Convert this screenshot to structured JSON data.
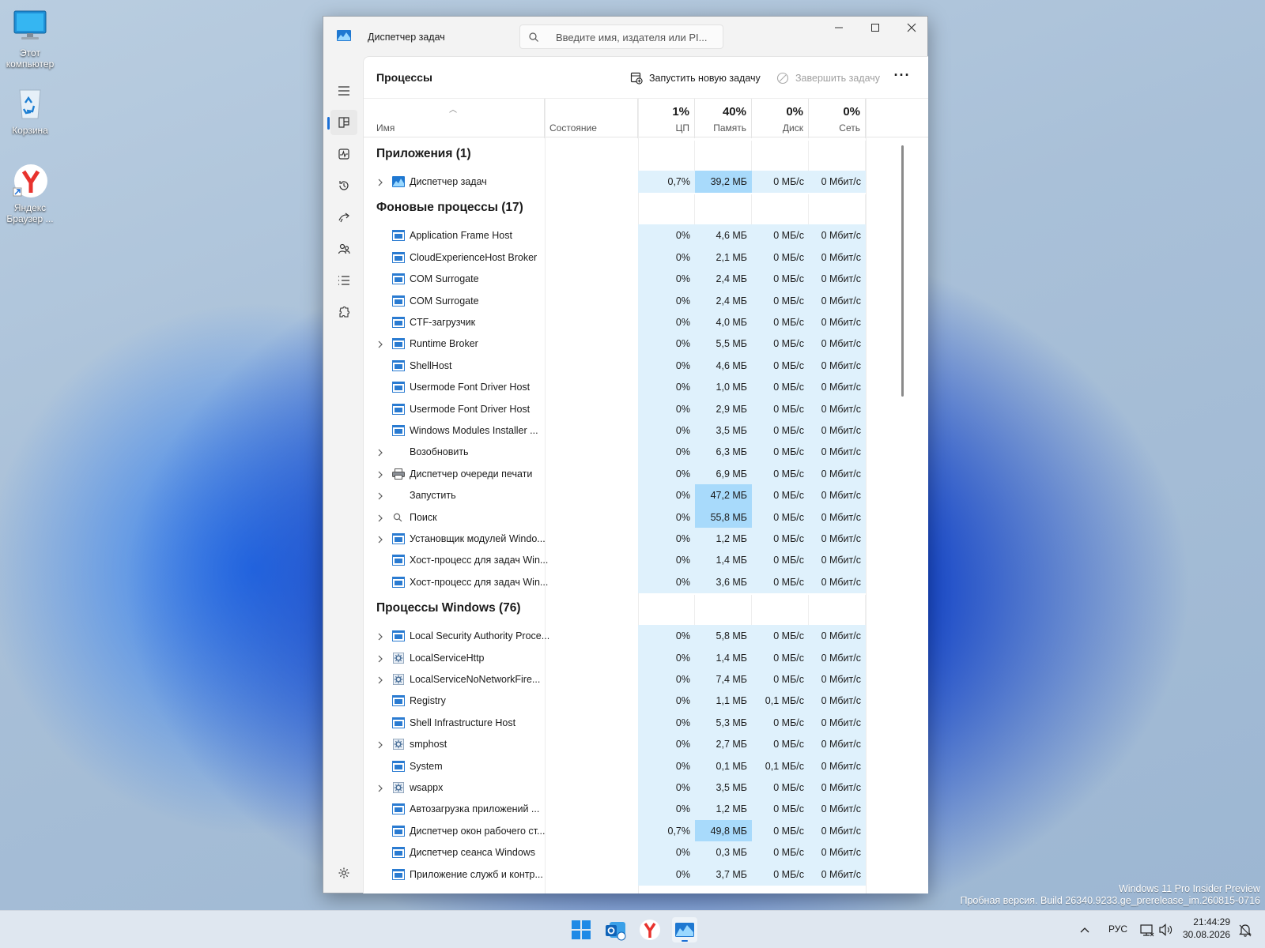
{
  "desktop": {
    "icons": [
      {
        "label": "Этот компьютер",
        "icon": "monitor-icon"
      },
      {
        "label": "Корзина",
        "icon": "recycle-bin-icon"
      },
      {
        "label": "Яндекс Браузер ...",
        "icon": "yandex-browser-icon"
      }
    ],
    "watermark_line1": "Windows 11 Pro Insider Preview",
    "watermark_line2": "Пробная версия. Build 26340.9233.ge_prerelease_im.260815-0716"
  },
  "window": {
    "title": "Диспетчер задач",
    "search_placeholder": "Введите имя, издателя или PI...",
    "page_title": "Процессы",
    "run_task": "Запустить новую задачу",
    "end_task": "Завершить задачу",
    "more": "···"
  },
  "columns": {
    "name": "Имя",
    "status": "Состояние",
    "cpu_pct": "1%",
    "cpu": "ЦП",
    "mem_pct": "40%",
    "mem": "Память",
    "disk_pct": "0%",
    "disk": "Диск",
    "net_pct": "0%",
    "net": "Сеть"
  },
  "groups": [
    {
      "title": "Приложения (1)",
      "rows": [
        {
          "name": "Диспетчер задач",
          "expand": true,
          "icon": "taskmgr",
          "cpu": "0,7%",
          "mem": "39,2 МБ",
          "disk": "0 МБ/с",
          "net": "0 Мбит/с",
          "mem_hi": true
        }
      ]
    },
    {
      "title": "Фоновые процессы (17)",
      "rows": [
        {
          "name": "Application Frame Host",
          "expand": false,
          "icon": "app",
          "cpu": "0%",
          "mem": "4,6 МБ",
          "disk": "0 МБ/с",
          "net": "0 Мбит/с"
        },
        {
          "name": "CloudExperienceHost Broker",
          "expand": false,
          "icon": "app",
          "cpu": "0%",
          "mem": "2,1 МБ",
          "disk": "0 МБ/с",
          "net": "0 Мбит/с"
        },
        {
          "name": "COM Surrogate",
          "expand": false,
          "icon": "app",
          "cpu": "0%",
          "mem": "2,4 МБ",
          "disk": "0 МБ/с",
          "net": "0 Мбит/с"
        },
        {
          "name": "COM Surrogate",
          "expand": false,
          "icon": "app",
          "cpu": "0%",
          "mem": "2,4 МБ",
          "disk": "0 МБ/с",
          "net": "0 Мбит/с"
        },
        {
          "name": "CTF-загрузчик",
          "expand": false,
          "icon": "app",
          "cpu": "0%",
          "mem": "4,0 МБ",
          "disk": "0 МБ/с",
          "net": "0 Мбит/с"
        },
        {
          "name": "Runtime Broker",
          "expand": true,
          "icon": "app",
          "cpu": "0%",
          "mem": "5,5 МБ",
          "disk": "0 МБ/с",
          "net": "0 Мбит/с"
        },
        {
          "name": "ShellHost",
          "expand": false,
          "icon": "app",
          "cpu": "0%",
          "mem": "4,6 МБ",
          "disk": "0 МБ/с",
          "net": "0 Мбит/с"
        },
        {
          "name": "Usermode Font Driver Host",
          "expand": false,
          "icon": "app",
          "cpu": "0%",
          "mem": "1,0 МБ",
          "disk": "0 МБ/с",
          "net": "0 Мбит/с"
        },
        {
          "name": "Usermode Font Driver Host",
          "expand": false,
          "icon": "app",
          "cpu": "0%",
          "mem": "2,9 МБ",
          "disk": "0 МБ/с",
          "net": "0 Мбит/с"
        },
        {
          "name": "Windows Modules Installer ...",
          "expand": false,
          "icon": "app",
          "cpu": "0%",
          "mem": "3,5 МБ",
          "disk": "0 МБ/с",
          "net": "0 Мбит/с"
        },
        {
          "name": "Возобновить",
          "expand": true,
          "icon": "none",
          "cpu": "0%",
          "mem": "6,3 МБ",
          "disk": "0 МБ/с",
          "net": "0 Мбит/с"
        },
        {
          "name": "Диспетчер очереди печати",
          "expand": true,
          "icon": "printer",
          "cpu": "0%",
          "mem": "6,9 МБ",
          "disk": "0 МБ/с",
          "net": "0 Мбит/с"
        },
        {
          "name": "Запустить",
          "expand": true,
          "icon": "none",
          "cpu": "0%",
          "mem": "47,2 МБ",
          "disk": "0 МБ/с",
          "net": "0 Мбит/с",
          "mem_hi": true
        },
        {
          "name": "Поиск",
          "expand": true,
          "icon": "search",
          "cpu": "0%",
          "mem": "55,8 МБ",
          "disk": "0 МБ/с",
          "net": "0 Мбит/с",
          "mem_hi": true
        },
        {
          "name": "Установщик модулей Windo...",
          "expand": true,
          "icon": "app",
          "cpu": "0%",
          "mem": "1,2 МБ",
          "disk": "0 МБ/с",
          "net": "0 Мбит/с"
        },
        {
          "name": "Хост-процесс для задач Win...",
          "expand": false,
          "icon": "app",
          "cpu": "0%",
          "mem": "1,4 МБ",
          "disk": "0 МБ/с",
          "net": "0 Мбит/с"
        },
        {
          "name": "Хост-процесс для задач Win...",
          "expand": false,
          "icon": "app",
          "cpu": "0%",
          "mem": "3,6 МБ",
          "disk": "0 МБ/с",
          "net": "0 Мбит/с"
        }
      ]
    },
    {
      "title": "Процессы Windows (76)",
      "rows": [
        {
          "name": "Local Security Authority Proce...",
          "expand": true,
          "icon": "app",
          "cpu": "0%",
          "mem": "5,8 МБ",
          "disk": "0 МБ/с",
          "net": "0 Мбит/с"
        },
        {
          "name": "LocalServiceHttp",
          "expand": true,
          "icon": "gear",
          "cpu": "0%",
          "mem": "1,4 МБ",
          "disk": "0 МБ/с",
          "net": "0 Мбит/с"
        },
        {
          "name": "LocalServiceNoNetworkFire...",
          "expand": true,
          "icon": "gear",
          "cpu": "0%",
          "mem": "7,4 МБ",
          "disk": "0 МБ/с",
          "net": "0 Мбит/с"
        },
        {
          "name": "Registry",
          "expand": false,
          "icon": "app",
          "cpu": "0%",
          "mem": "1,1 МБ",
          "disk": "0,1 МБ/с",
          "net": "0 Мбит/с"
        },
        {
          "name": "Shell Infrastructure Host",
          "expand": false,
          "icon": "app",
          "cpu": "0%",
          "mem": "5,3 МБ",
          "disk": "0 МБ/с",
          "net": "0 Мбит/с"
        },
        {
          "name": "smphost",
          "expand": true,
          "icon": "gear",
          "cpu": "0%",
          "mem": "2,7 МБ",
          "disk": "0 МБ/с",
          "net": "0 Мбит/с"
        },
        {
          "name": "System",
          "expand": false,
          "icon": "app",
          "cpu": "0%",
          "mem": "0,1 МБ",
          "disk": "0,1 МБ/с",
          "net": "0 Мбит/с"
        },
        {
          "name": "wsappx",
          "expand": true,
          "icon": "gear",
          "cpu": "0%",
          "mem": "3,5 МБ",
          "disk": "0 МБ/с",
          "net": "0 Мбит/с"
        },
        {
          "name": "Автозагрузка приложений ...",
          "expand": false,
          "icon": "app",
          "cpu": "0%",
          "mem": "1,2 МБ",
          "disk": "0 МБ/с",
          "net": "0 Мбит/с"
        },
        {
          "name": "Диспетчер окон рабочего ст...",
          "expand": false,
          "icon": "app",
          "cpu": "0,7%",
          "mem": "49,8 МБ",
          "disk": "0 МБ/с",
          "net": "0 Мбит/с",
          "mem_hi": true
        },
        {
          "name": "Диспетчер сеанса  Windows",
          "expand": false,
          "icon": "app",
          "cpu": "0%",
          "mem": "0,3 МБ",
          "disk": "0 МБ/с",
          "net": "0 Мбит/с"
        },
        {
          "name": "Приложение служб и контр...",
          "expand": false,
          "icon": "app",
          "cpu": "0%",
          "mem": "3,7 МБ",
          "disk": "0 МБ/с",
          "net": "0 Мбит/с"
        }
      ]
    }
  ],
  "taskbar": {
    "apps": [
      "start-icon",
      "outlook-icon",
      "yandex-browser-icon",
      "task-manager-icon"
    ],
    "lang": "РУС",
    "time": "21:44:29",
    "date": "30.08.2026"
  },
  "colors": {
    "accent": "#1a6fd6",
    "cell": "#dff1fc",
    "cell_hi": "#a8dafb"
  }
}
